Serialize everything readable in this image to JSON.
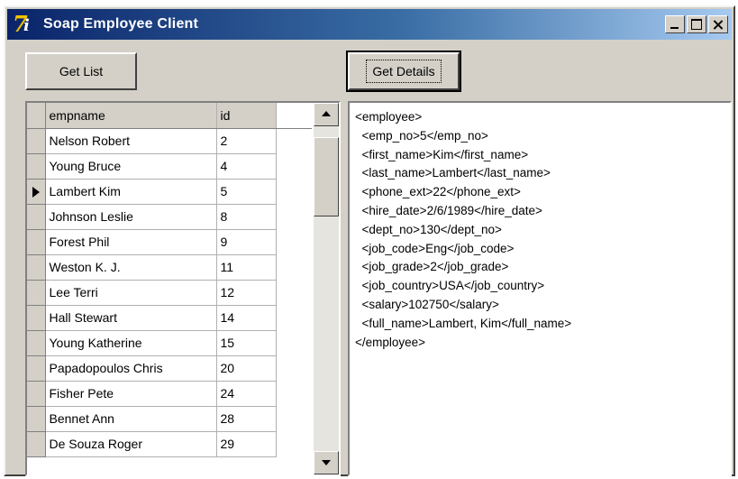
{
  "window": {
    "title": "Soap Employee Client",
    "icon": "delphi-7-app-icon",
    "icon_glyph": "7",
    "icon_glyph2": "i",
    "title_gradient": [
      "#0a246a",
      "#a6caf0"
    ]
  },
  "toolbar": {
    "get_list_label": "Get List",
    "get_details_label": "Get Details"
  },
  "grid": {
    "columns": [
      "empname",
      "id"
    ],
    "selected_index": 2,
    "rows": [
      {
        "empname": "Nelson Robert",
        "id": "2"
      },
      {
        "empname": "Young Bruce",
        "id": "4"
      },
      {
        "empname": "Lambert Kim",
        "id": "5"
      },
      {
        "empname": "Johnson Leslie",
        "id": "8"
      },
      {
        "empname": "Forest Phil",
        "id": "9"
      },
      {
        "empname": "Weston K. J.",
        "id": "11"
      },
      {
        "empname": "Lee Terri",
        "id": "12"
      },
      {
        "empname": "Hall Stewart",
        "id": "14"
      },
      {
        "empname": "Young Katherine",
        "id": "15"
      },
      {
        "empname": "Papadopoulos Chris",
        "id": "20"
      },
      {
        "empname": "Fisher Pete",
        "id": "24"
      },
      {
        "empname": "Bennet Ann",
        "id": "28"
      },
      {
        "empname": "De Souza Roger",
        "id": "29"
      }
    ]
  },
  "details": {
    "lines": [
      "<employee>",
      "  <emp_no>5</emp_no>",
      "  <first_name>Kim</first_name>",
      "  <last_name>Lambert</last_name>",
      "  <phone_ext>22</phone_ext>",
      "  <hire_date>2/6/1989</hire_date>",
      "  <dept_no>130</dept_no>",
      "  <job_code>Eng</job_code>",
      "  <job_grade>2</job_grade>",
      "  <job_country>USA</job_country>",
      "  <salary>102750</salary>",
      "  <full_name>Lambert, Kim</full_name>",
      "</employee>"
    ]
  }
}
